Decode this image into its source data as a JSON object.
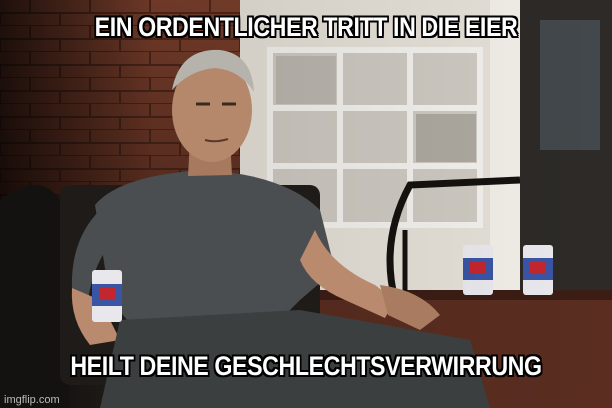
{
  "meme": {
    "top_text": "EIN ORDENTLICHER TRITT IN DIE EIER",
    "bottom_text": "HEILT DEINE GESCHLECHTSVERWIRRUNG",
    "watermark": "imgflip.com"
  }
}
